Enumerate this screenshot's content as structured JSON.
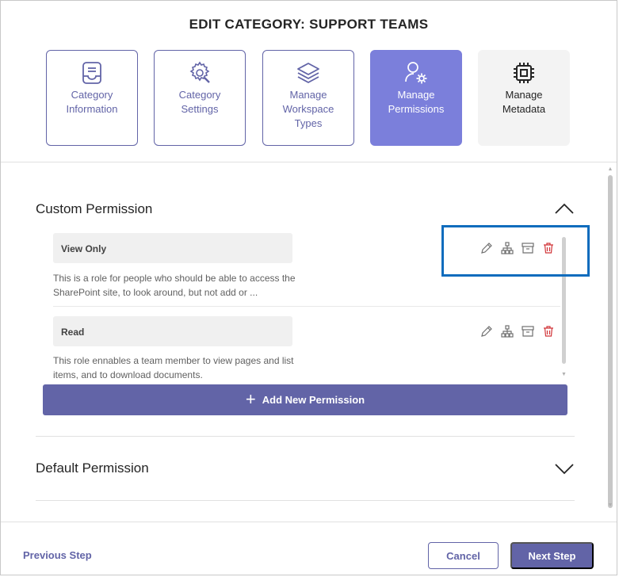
{
  "dialog": {
    "title": "EDIT CATEGORY: SUPPORT TEAMS"
  },
  "steps": [
    {
      "label": "Category\nInformation",
      "icon": "inbox-icon",
      "state": "default"
    },
    {
      "label": "Category\nSettings",
      "icon": "gear-wrench-icon",
      "state": "default"
    },
    {
      "label": "Manage\nWorkspace\nTypes",
      "icon": "layers-icon",
      "state": "default"
    },
    {
      "label": "Manage\nPermissions",
      "icon": "person-gear-icon",
      "state": "active"
    },
    {
      "label": "Manage\nMetadata",
      "icon": "chip-icon",
      "state": "disabled"
    }
  ],
  "custom_section": {
    "title": "Custom Permission",
    "expanded": true,
    "permissions": [
      {
        "name": "View Only",
        "description": "This is a role for people who should be able to access the SharePoint site, to look around, but not add or ..."
      },
      {
        "name": "Read",
        "description": "This role ennables a team member to view pages and list items, and to download documents."
      }
    ],
    "action_icons": [
      "pencil-icon",
      "hierarchy-icon",
      "archive-icon",
      "trash-icon"
    ],
    "add_label": "Add New Permission"
  },
  "default_section": {
    "title": "Default Permission",
    "expanded": false
  },
  "footer": {
    "previous_label": "Previous Step",
    "cancel_label": "Cancel",
    "next_label": "Next Step"
  },
  "colors": {
    "accent": "#6264a7",
    "active_step": "#7b7fdb",
    "delete": "#d13438",
    "highlight": "#0f6cbd"
  }
}
